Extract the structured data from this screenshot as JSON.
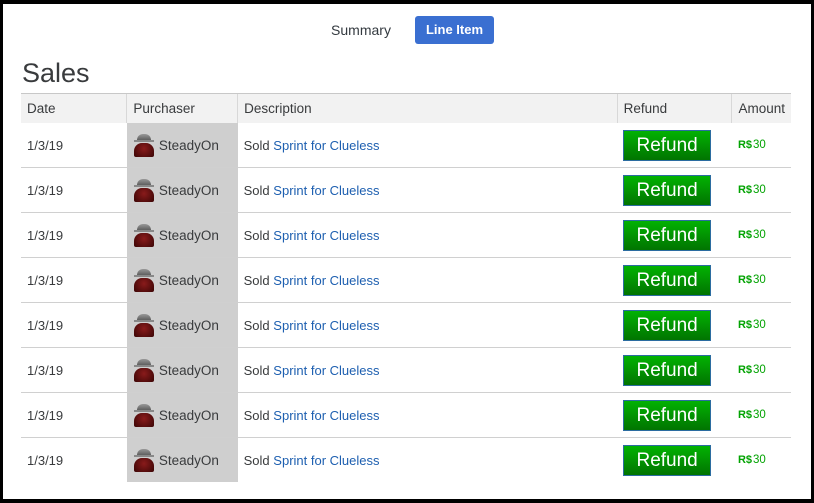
{
  "tabs": [
    {
      "label": "Summary",
      "active": false
    },
    {
      "label": "Line Item",
      "active": true
    }
  ],
  "title": "Sales",
  "columns": [
    "Date",
    "Purchaser",
    "Description",
    "Refund",
    "Amount"
  ],
  "currency_icon": "robux-icon",
  "currency_symbol": "R$",
  "rows": [
    {
      "date": "1/3/19",
      "purchaser": "SteadyOn",
      "desc_prefix": "Sold",
      "item": "Sprint for Clueless",
      "refund_label": "Refund",
      "amount": "30"
    },
    {
      "date": "1/3/19",
      "purchaser": "SteadyOn",
      "desc_prefix": "Sold",
      "item": "Sprint for Clueless",
      "refund_label": "Refund",
      "amount": "30"
    },
    {
      "date": "1/3/19",
      "purchaser": "SteadyOn",
      "desc_prefix": "Sold",
      "item": "Sprint for Clueless",
      "refund_label": "Refund",
      "amount": "30"
    },
    {
      "date": "1/3/19",
      "purchaser": "SteadyOn",
      "desc_prefix": "Sold",
      "item": "Sprint for Clueless",
      "refund_label": "Refund",
      "amount": "30"
    },
    {
      "date": "1/3/19",
      "purchaser": "SteadyOn",
      "desc_prefix": "Sold",
      "item": "Sprint for Clueless",
      "refund_label": "Refund",
      "amount": "30"
    },
    {
      "date": "1/3/19",
      "purchaser": "SteadyOn",
      "desc_prefix": "Sold",
      "item": "Sprint for Clueless",
      "refund_label": "Refund",
      "amount": "30"
    },
    {
      "date": "1/3/19",
      "purchaser": "SteadyOn",
      "desc_prefix": "Sold",
      "item": "Sprint for Clueless",
      "refund_label": "Refund",
      "amount": "30"
    },
    {
      "date": "1/3/19",
      "purchaser": "SteadyOn",
      "desc_prefix": "Sold",
      "item": "Sprint for Clueless",
      "refund_label": "Refund",
      "amount": "30"
    }
  ]
}
